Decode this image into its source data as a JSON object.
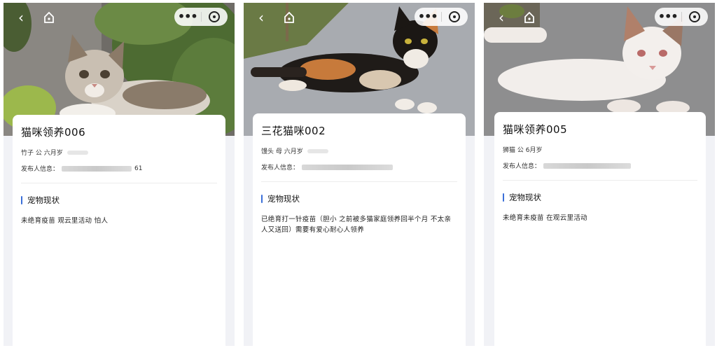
{
  "screens": [
    {
      "title": "猫咪领养006",
      "meta": "竹子  公  六月岁",
      "publisher_label": "发布人信息：",
      "publisher_tail": "61",
      "section_title": "宠物现状",
      "status": "未绝育疫苗 观云里活动 怕人"
    },
    {
      "title": "三花猫咪002",
      "meta": "馒头  母  六月岁",
      "publisher_label": "发布人信息：",
      "publisher_tail": "",
      "section_title": "宠物现状",
      "status": "已绝育打一针疫苗（胆小 之前被多猫家庭领养回半个月 不太亲人又送回）需要有爱心耐心人领养"
    },
    {
      "title": "猫咪领养005",
      "meta": "狮猫  公  6月岁",
      "publisher_label": "发布人信息：",
      "publisher_tail": "",
      "section_title": "宠物现状",
      "status": "未绝育未疫苗 在观云里活动"
    }
  ],
  "icons": {
    "back": "chevron-left-icon",
    "home": "home-icon",
    "more": "more-dots-icon",
    "close": "target-close-icon"
  },
  "colors": {
    "accent": "#3b6fd8",
    "page_bg": "#f1f2f6",
    "card_bg": "#ffffff"
  }
}
